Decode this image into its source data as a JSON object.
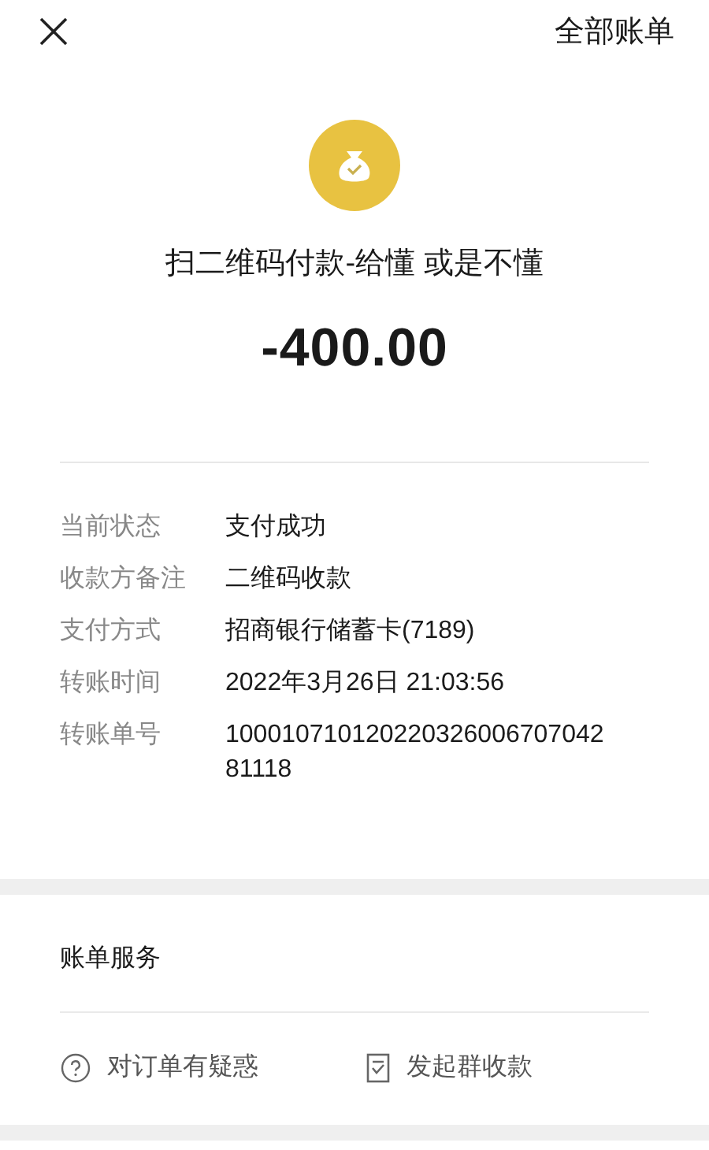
{
  "top_bar": {
    "all_bills_link": "全部账单"
  },
  "header": {
    "title": "扫二维码付款-给懂 或是不懂",
    "amount": "-400.00"
  },
  "details": [
    {
      "label": "当前状态",
      "value": "支付成功"
    },
    {
      "label": "收款方备注",
      "value": "二维码收款"
    },
    {
      "label": "支付方式",
      "value": "招商银行储蓄卡(7189)"
    },
    {
      "label": "转账时间",
      "value": "2022年3月26日 21:03:56"
    },
    {
      "label": "转账单号",
      "value": "10001071012022032600670704281118"
    }
  ],
  "services": {
    "title": "账单服务",
    "actions": [
      {
        "kind": "question",
        "label": "对订单有疑惑"
      },
      {
        "kind": "group_collect",
        "label": "发起群收款"
      }
    ]
  }
}
